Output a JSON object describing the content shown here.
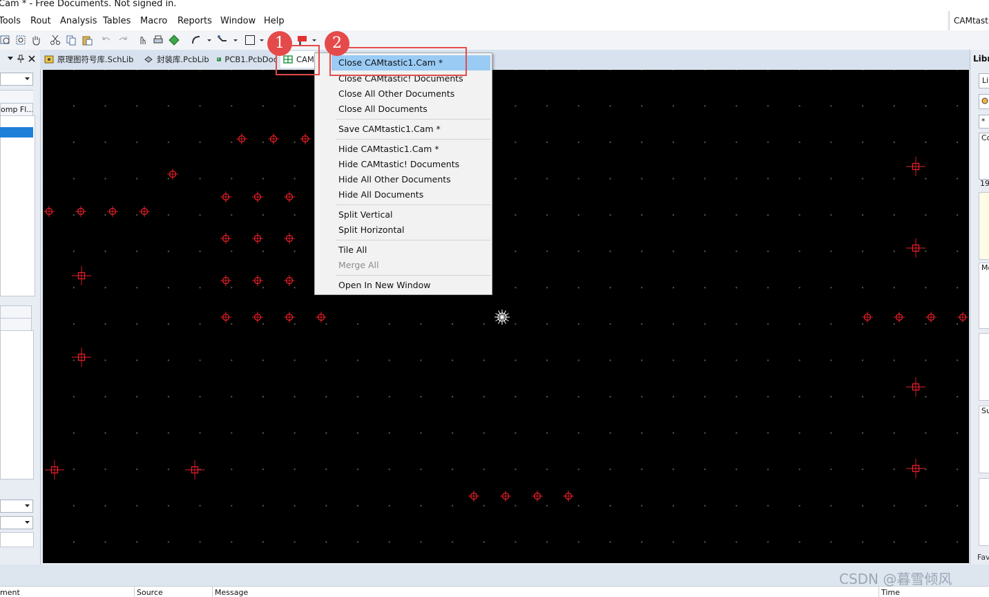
{
  "window": {
    "title": "Cam * - Free Documents. Not signed in.",
    "right_label": "CAMtasti"
  },
  "menu": [
    "Tools",
    "Rout",
    "Analysis",
    "Tables",
    "Macro",
    "Reports",
    "Window",
    "Help"
  ],
  "tabs": [
    {
      "label": "原理图符号库.SchLib"
    },
    {
      "label": "封装库.PcbLib"
    },
    {
      "label": "PCB1.PcbDoc"
    },
    {
      "label": "CAM"
    }
  ],
  "left_panel": {
    "comp_filter": "omp Fl..."
  },
  "right_panel": {
    "title": "Libr",
    "labels": [
      "Lil",
      "*",
      "Co",
      "19",
      "Mo",
      "Su",
      "Fav"
    ]
  },
  "context_menu": {
    "items": [
      {
        "label": "Close CAMtastic1.Cam *",
        "state": "highlighted"
      },
      {
        "label": "Close CAMtastic! Documents"
      },
      {
        "label": "Close All Other Documents"
      },
      {
        "label": "Close All Documents"
      },
      {
        "label": "Save CAMtastic1.Cam *"
      },
      {
        "label": "Hide CAMtastic1.Cam *"
      },
      {
        "label": "Hide CAMtastic! Documents"
      },
      {
        "label": "Hide All Other Documents"
      },
      {
        "label": "Hide All Documents"
      },
      {
        "label": "Split Vertical"
      },
      {
        "label": "Split Horizontal"
      },
      {
        "label": "Tile All"
      },
      {
        "label": "Merge All",
        "state": "disabled"
      },
      {
        "label": "Open In New Window"
      }
    ]
  },
  "callouts": [
    "1",
    "2"
  ],
  "messages": {
    "columns": [
      "ment",
      "Source",
      "Message",
      "Time"
    ]
  },
  "watermark": "CSDN @暮雪倾风",
  "colors": {
    "canvas": "#000000",
    "pad": "#e8202a",
    "highlight": "#99cbf5",
    "callout": "#e54a4a"
  }
}
